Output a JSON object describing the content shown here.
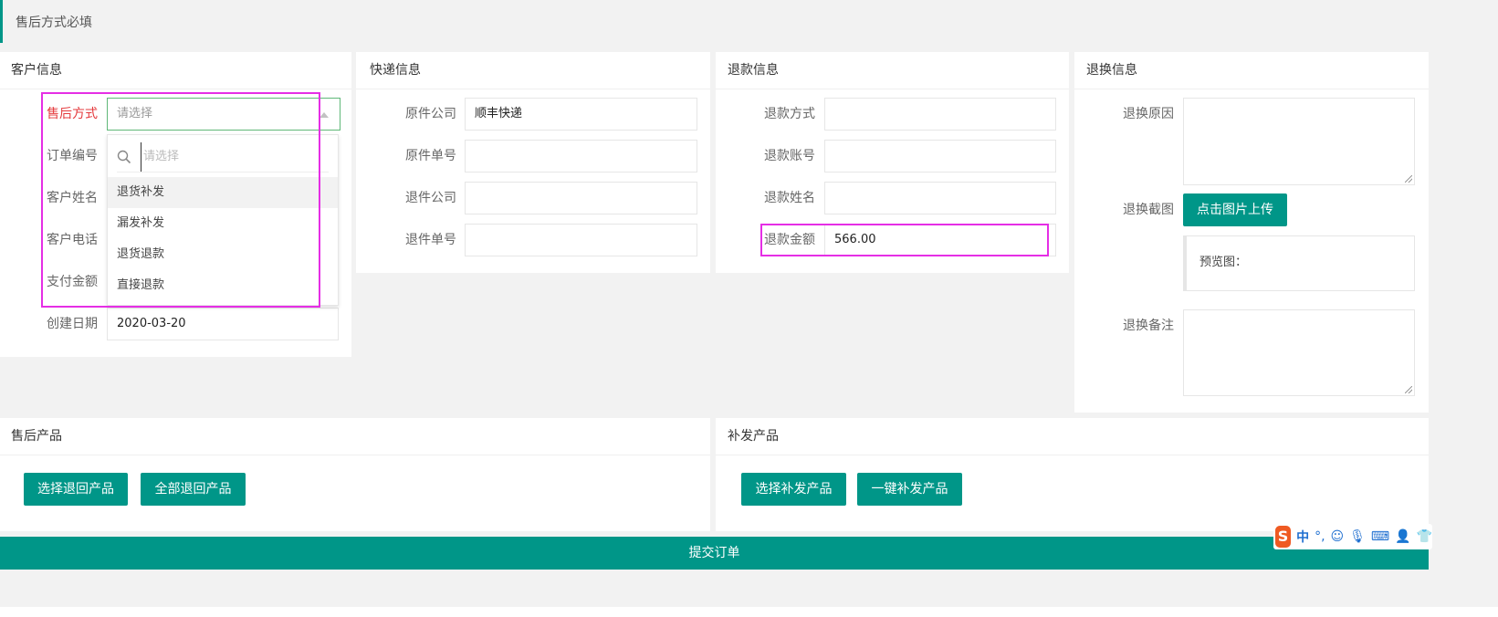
{
  "notice": "售后方式必填",
  "customer": {
    "header": "客户信息",
    "after_sale_label": "售后方式",
    "select_placeholder": "请选择",
    "order_no_label": "订单编号",
    "name_label": "客户姓名",
    "phone_label": "客户电话",
    "amount_label": "支付金额",
    "created_label": "创建日期",
    "created_value": "2020-03-20",
    "dropdown": {
      "search_placeholder": "请选择",
      "options": [
        "退货补发",
        "漏发补发",
        "退货退款",
        "直接退款"
      ]
    }
  },
  "express": {
    "header": "快递信息",
    "fields": [
      {
        "label": "原件公司",
        "value": "顺丰快递"
      },
      {
        "label": "原件单号",
        "value": ""
      },
      {
        "label": "退件公司",
        "value": ""
      },
      {
        "label": "退件单号",
        "value": ""
      }
    ]
  },
  "refund": {
    "header": "退款信息",
    "fields": [
      {
        "label": "退款方式",
        "value": ""
      },
      {
        "label": "退款账号",
        "value": ""
      },
      {
        "label": "退款姓名",
        "value": ""
      },
      {
        "label": "退款金额",
        "value": "566.00"
      }
    ]
  },
  "exchange": {
    "header": "退换信息",
    "reason_label": "退换原因",
    "screenshot_label": "退换截图",
    "upload_button": "点击图片上传",
    "preview_label": "预览图：",
    "remark_label": "退换备注"
  },
  "aftersale_products": {
    "header": "售后产品",
    "select_button": "选择退回产品",
    "all_button": "全部退回产品"
  },
  "reissue_products": {
    "header": "补发产品",
    "select_button": "选择补发产品",
    "all_button": "一键补发产品"
  },
  "submit_label": "提交订单",
  "ime": {
    "logo": "S",
    "lang": "中",
    "punct": "°,"
  }
}
